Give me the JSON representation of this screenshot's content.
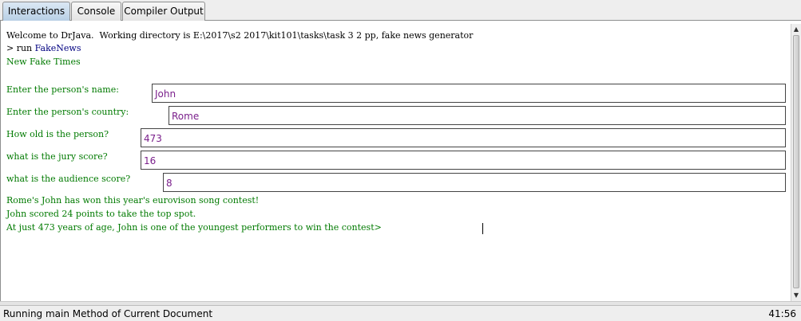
{
  "tabs": [
    {
      "label": "Interactions",
      "active": true
    },
    {
      "label": "Console",
      "active": false
    },
    {
      "label": "Compiler Output",
      "active": false
    }
  ],
  "console": {
    "welcome": "Welcome to DrJava.  Working directory is E:\\2017\\s2 2017\\kit101\\tasks\\task 3 2 pp, fake news generator",
    "prompt": "> ",
    "command": "run",
    "class_name": "FakeNews",
    "title_line": "New Fake Times",
    "prompts": [
      {
        "label": "Enter the person's name:",
        "value": "John"
      },
      {
        "label": "Enter the person's country:",
        "value": "Rome"
      },
      {
        "label": "How old is the person?",
        "value": "473"
      },
      {
        "label": "what is the jury score?",
        "value": "16"
      },
      {
        "label": "what is the audience score?",
        "value": "8"
      }
    ],
    "output": [
      "Rome's John has won this year's eurovison song contest!",
      "John scored 24 points to take the top spot.",
      "At just 473 years of age, John is one of the youngest performers to win the contest>"
    ]
  },
  "status": {
    "message": "Running main Method of Current Document",
    "position": "41:56"
  },
  "colors": {
    "output_text": "#007a00",
    "input_text": "#7a1f8b",
    "active_tab": "#b8cfe5"
  }
}
